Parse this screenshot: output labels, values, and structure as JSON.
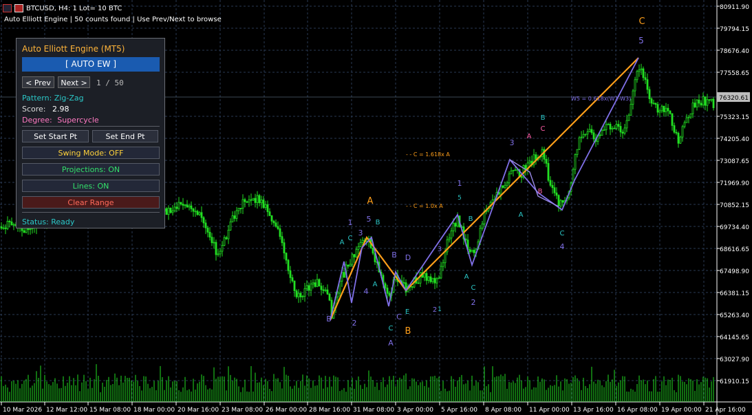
{
  "window": {
    "title": "BTCUSD, H4:  1 Lot= 10 BTC",
    "subtitle": "Auto Elliott Engine | 50 counts found | Use Prev/Next to browse"
  },
  "panel": {
    "title": "Auto Elliott Engine (MT5)",
    "auto_label": "[ AUTO EW ]",
    "prev_label": "< Prev",
    "next_label": "Next >",
    "count": "1  /  50",
    "pattern_label": "Pattern: Zig-Zag",
    "score_key": "Score:",
    "score_value": "2.98",
    "degree_key": "Degree:",
    "degree_value": "Supercycle",
    "set_start": "Set Start Pt",
    "set_end": "Set End Pt",
    "swing_mode": "Swing Mode: OFF",
    "projections": "Projections: ON",
    "lines": "Lines: ON",
    "clear_range": "Clear Range",
    "status": "Status: Ready"
  },
  "colors": {
    "bull": "#22e022",
    "orange": "#ff9f1a",
    "purple": "#8070e8",
    "cyan": "#2bc7c7",
    "pink": "#ff5fa8",
    "grid": "#2a3a55"
  },
  "chart_data": {
    "type": "candlestick",
    "symbol": "BTCUSD",
    "timeframe": "H4",
    "y_ticks": [
      "80911.90",
      "79794.15",
      "78676.40",
      "77558.65",
      "75323.15",
      "74205.40",
      "73087.65",
      "71969.90",
      "70852.15",
      "69734.40",
      "68616.65",
      "67498.90",
      "66381.15",
      "65263.40",
      "64145.65",
      "63027.90",
      "61910.15"
    ],
    "x_ticks": [
      "10 Mar 2026",
      "12 Mar 12:00",
      "15 Mar 08:00",
      "18 Mar 00:00",
      "20 Mar 16:00",
      "23 Mar 08:00",
      "26 Mar 00:00",
      "28 Mar 16:00",
      "31 Mar 08:00",
      "3 Apr 00:00",
      "5 Apr 16:00",
      "8 Apr 08:00",
      "11 Apr 00:00",
      "13 Apr 16:00",
      "16 Apr 08:00",
      "19 Apr 00:00",
      "21 Apr 16:00"
    ],
    "current_price": "76320.61",
    "projection_labels": [
      "C = 1.618x A",
      "C = 1.0x A",
      "W5 = 0.618x(W1-W3)"
    ],
    "wave_labels": {
      "orange": [
        "A",
        "B",
        "C"
      ],
      "purple": [
        "1",
        "2",
        "3",
        "4",
        "5"
      ],
      "cyan": [
        "A",
        "B",
        "C",
        "D",
        "E"
      ],
      "pink": [
        "A",
        "B",
        "C"
      ]
    }
  }
}
